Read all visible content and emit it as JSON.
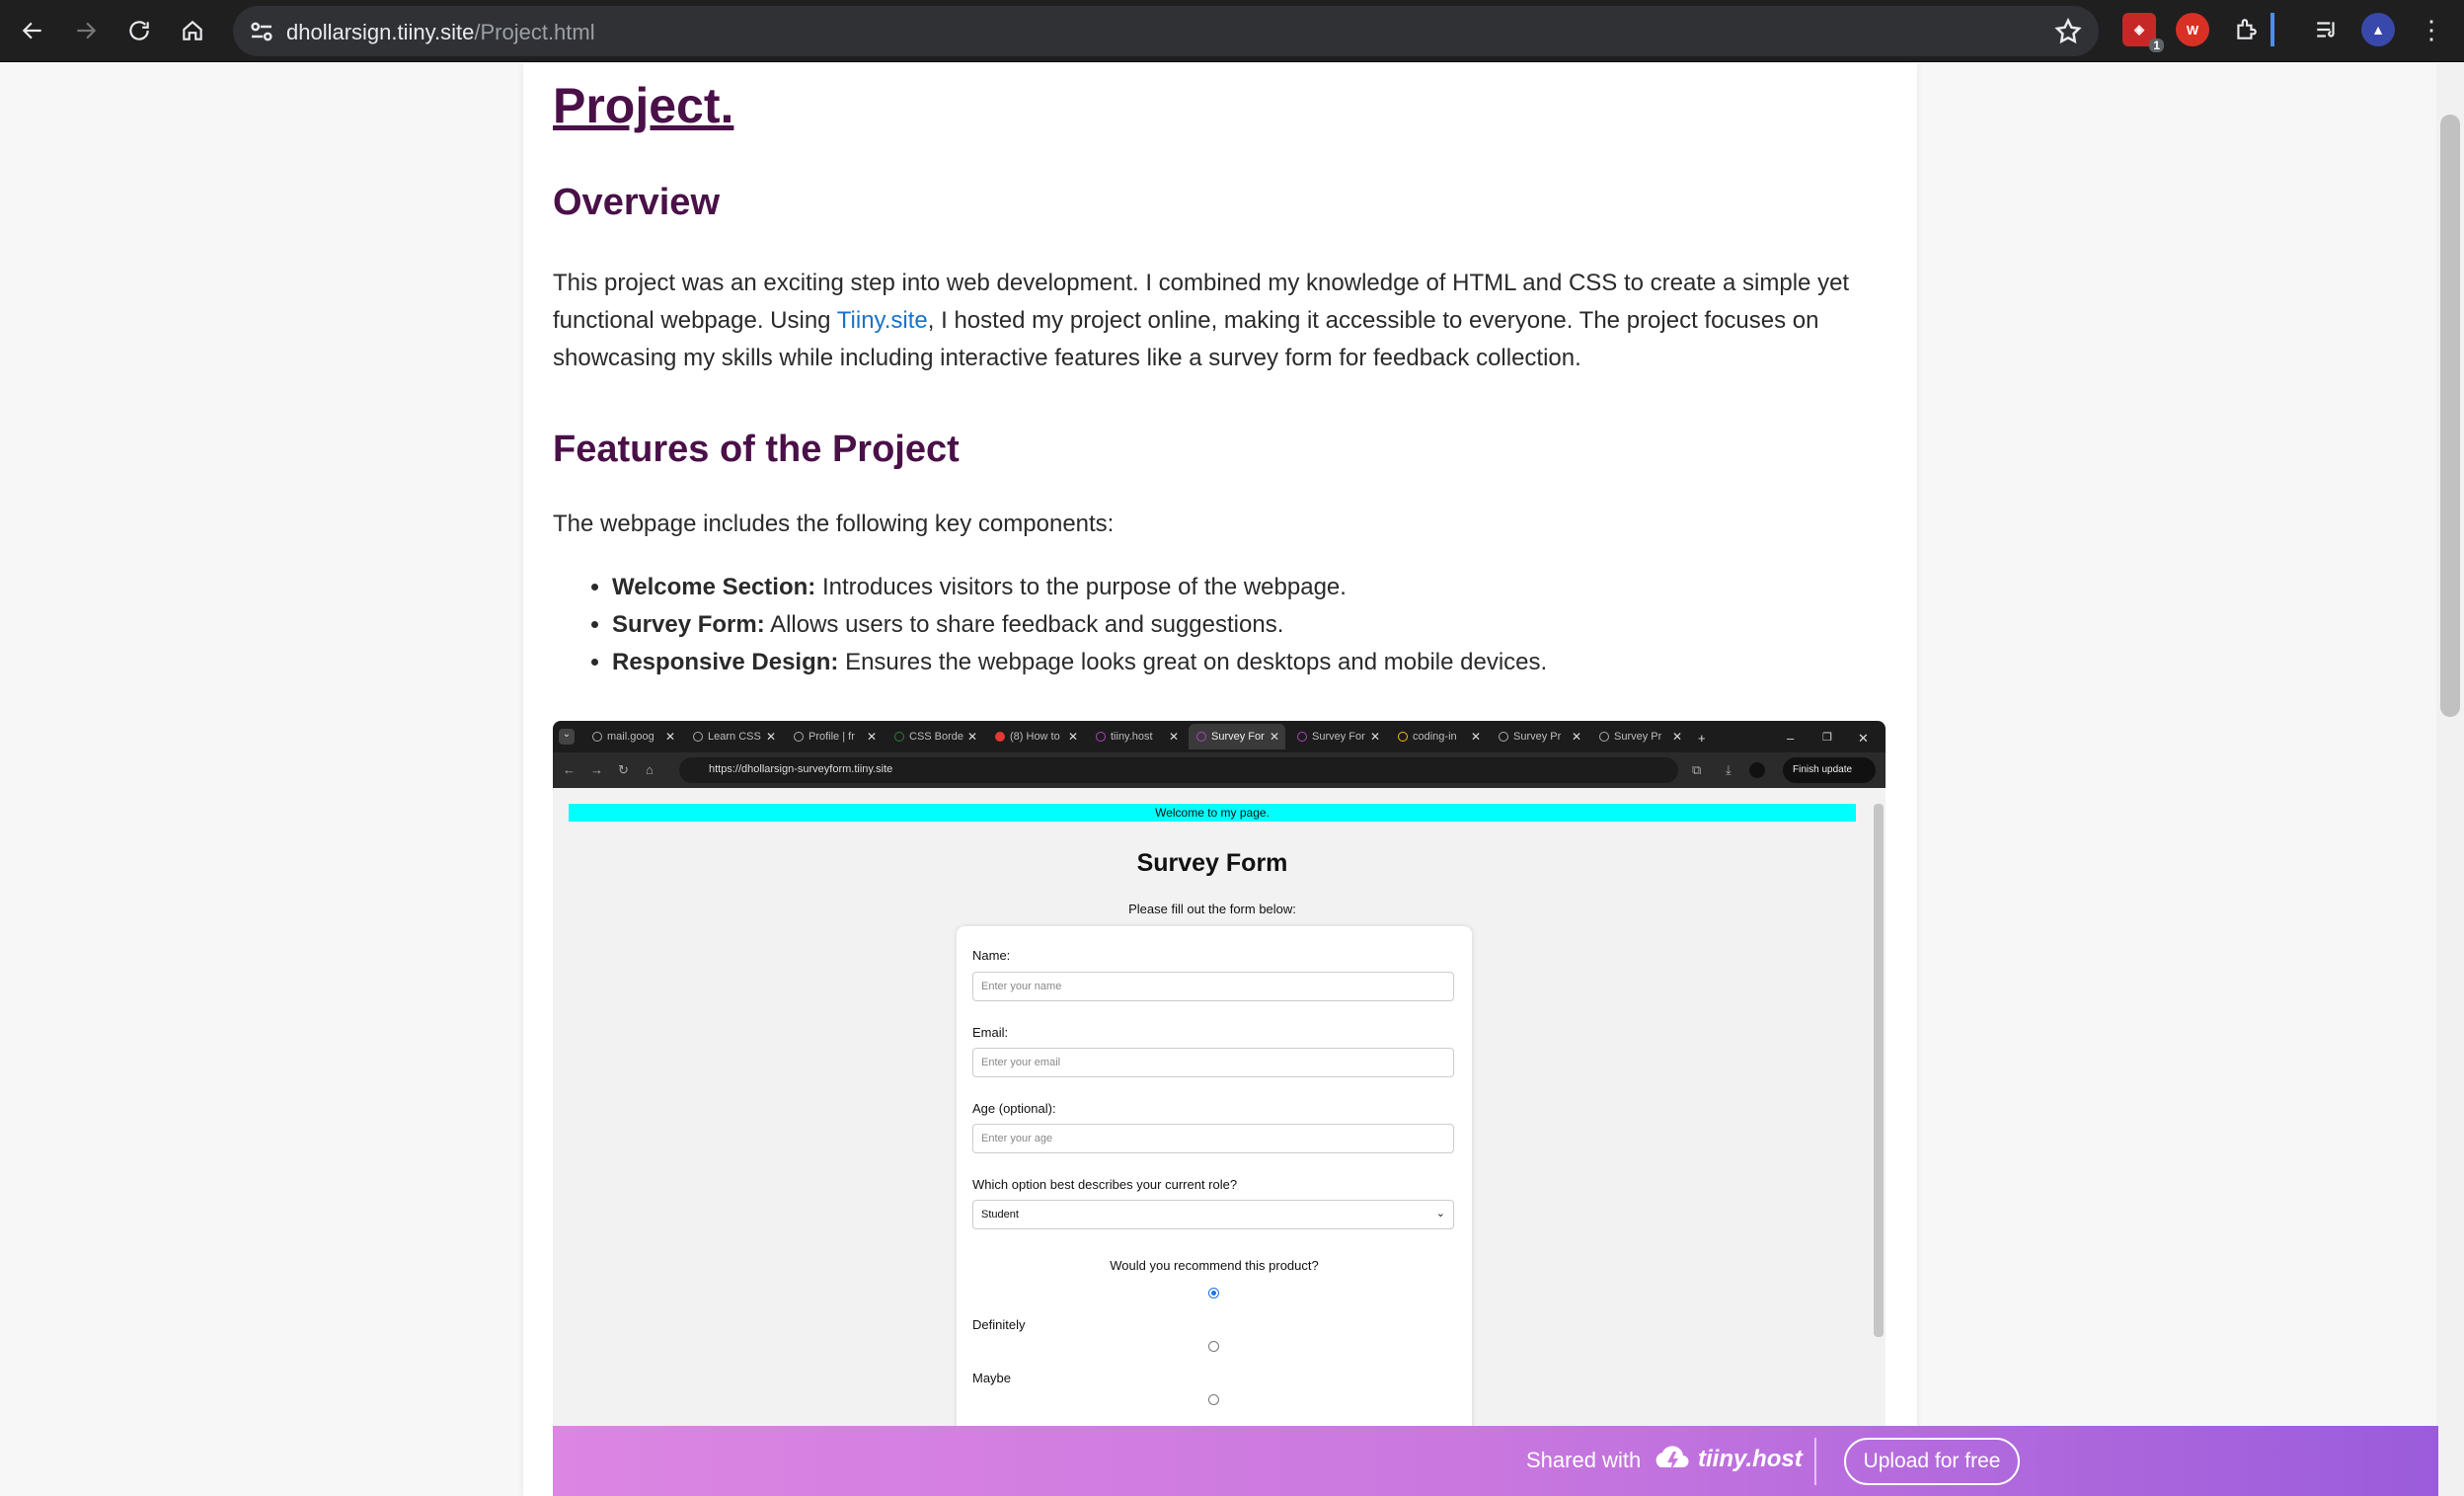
{
  "browser": {
    "url_host": "dhollarsign.tiiny.site",
    "url_path": "/Project.html",
    "extension_badge": "1",
    "ext_red_label": "W"
  },
  "page": {
    "title": "Project.",
    "overview_heading": "Overview",
    "overview_text_1": "This project was an exciting step into web development. I combined my knowledge of HTML and CSS to create a simple yet functional webpage. Using ",
    "overview_link": "Tiiny.site",
    "overview_text_2": ", I hosted my project online, making it accessible to everyone. The project focuses on showcasing my skills while including interactive features like a survey form for feedback collection.",
    "features_heading": "Features of the Project",
    "features_intro": "The webpage includes the following key components:",
    "features": [
      {
        "title": "Welcome Section:",
        "text": " Introduces visitors to the purpose of the webpage."
      },
      {
        "title": "Survey Form:",
        "text": " Allows users to share feedback and suggestions."
      },
      {
        "title": "Responsive Design:",
        "text": " Ensures the webpage looks great on desktops and mobile devices."
      }
    ]
  },
  "screenshot": {
    "tabs": [
      "mail.goog",
      "Learn CSS",
      "Profile | fr",
      "CSS Borde",
      "(8) How to",
      "tiiny.host",
      "Survey For",
      "Survey For",
      "coding-in",
      "Survey Pr",
      "Survey Pr"
    ],
    "new_tab": "+",
    "url": "https://dhollarsign-surveyform.tiiny.site",
    "finish_update": "Finish update",
    "welcome_text": "Welcome to my page.",
    "form_title": "Survey Form",
    "form_subtitle": "Please fill out the form below:",
    "name_label": "Name:",
    "name_placeholder": "Enter your name",
    "email_label": "Email:",
    "email_placeholder": "Enter your email",
    "age_label": "Age (optional):",
    "age_placeholder": "Enter your age",
    "role_label": "Which option best describes your current role?",
    "role_value": "Student",
    "recommend_question": "Would you recommend this product?",
    "option_definitely": "Definitely",
    "option_maybe": "Maybe"
  },
  "banner": {
    "shared_with": "Shared with",
    "brand": "tiiny.host",
    "upload_button": "Upload for free"
  },
  "colors": {
    "heading": "#4a1048",
    "link": "#1a73c8",
    "welcome_bar": "#00ffff",
    "banner_start": "#dc85e3",
    "banner_end": "#9b5cdb"
  }
}
